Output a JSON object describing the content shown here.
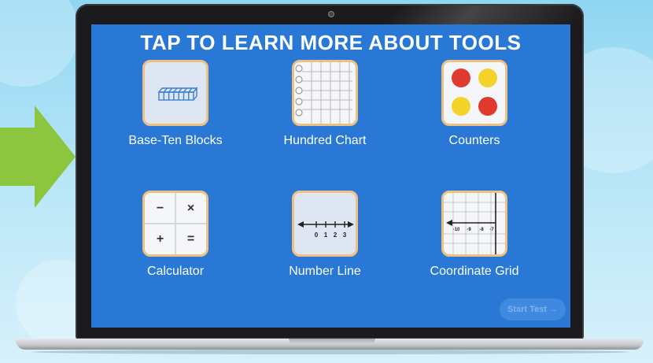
{
  "screen": {
    "title": "TAP TO LEARN MORE ABOUT TOOLS",
    "tools": [
      {
        "label": "Base-Ten Blocks",
        "icon": "base-ten-blocks-icon"
      },
      {
        "label": "Hundred Chart",
        "icon": "hundred-chart-icon"
      },
      {
        "label": "Counters",
        "icon": "counters-icon"
      },
      {
        "label": "Calculator",
        "icon": "calculator-icon"
      },
      {
        "label": "Number Line",
        "icon": "number-line-icon"
      },
      {
        "label": "Coordinate Grid",
        "icon": "coordinate-grid-icon"
      }
    ],
    "calculator_keys": [
      "−",
      "×",
      "+",
      "="
    ],
    "number_line_ticks": [
      "0",
      "1",
      "2",
      "3"
    ],
    "coordinate_grid_ticks": [
      "-10",
      "-9",
      "-8",
      "-7"
    ],
    "start_button": "Start Test →"
  },
  "colors": {
    "screen_bg": "#2a78d6",
    "arrow": "#8cc63f",
    "counter_red": "#e03a2f",
    "counter_yellow": "#f5d32b",
    "tile_border": "#f0c080"
  }
}
